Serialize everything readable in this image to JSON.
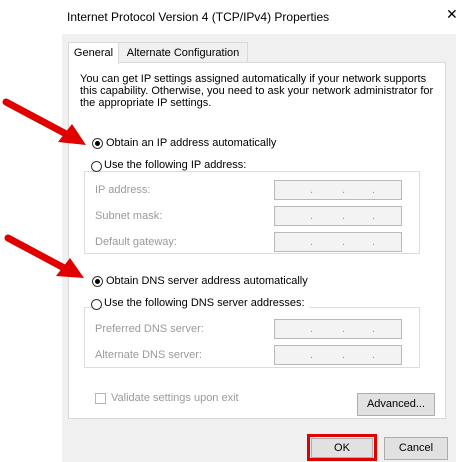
{
  "window": {
    "title": "Internet Protocol Version 4 (TCP/IPv4) Properties",
    "close_glyph": "✕"
  },
  "tabs": [
    {
      "label": "General",
      "active": true
    },
    {
      "label": "Alternate Configuration",
      "active": false
    }
  ],
  "description": "You can get IP settings assigned automatically if your network supports this capability. Otherwise, you need to ask your network administrator for the appropriate IP settings.",
  "ip": {
    "auto_label": "Obtain an IP address automatically",
    "manual_label": "Use the following IP address:",
    "selected": "auto",
    "fields": [
      {
        "label": "IP address:",
        "value": ". . ."
      },
      {
        "label": "Subnet mask:",
        "value": ". . ."
      },
      {
        "label": "Default gateway:",
        "value": ". . ."
      }
    ]
  },
  "dns": {
    "auto_label": "Obtain DNS server address automatically",
    "manual_label": "Use the following DNS server addresses:",
    "selected": "auto",
    "fields": [
      {
        "label": "Preferred DNS server:",
        "value": ". . ."
      },
      {
        "label": "Alternate DNS server:",
        "value": ". . ."
      }
    ]
  },
  "validate": {
    "label": "Validate settings upon exit",
    "checked": false,
    "enabled": false
  },
  "buttons": {
    "advanced": "Advanced...",
    "ok": "OK",
    "cancel": "Cancel"
  },
  "annotation_color": "#e00000"
}
